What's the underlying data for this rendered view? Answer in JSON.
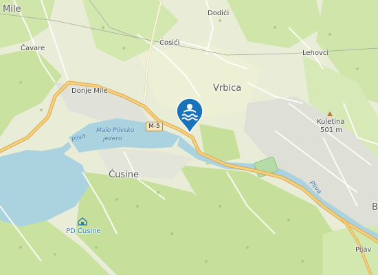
{
  "map": {
    "places": {
      "mile": "Mile",
      "cavare": "Čavare",
      "donje_mile": "Donje Mile",
      "cosici": "Ćosići",
      "dodici": "Dodići",
      "lehovci": "Lehovci",
      "vrbica": "Vrbica",
      "kuletina": "Kuletina",
      "kuletina_elev": "501 m",
      "cusine": "Ćusine",
      "pijav": "Pijav",
      "edge_b": "B"
    },
    "water": {
      "river_pliva_west": "Pliva",
      "lake": "Malo Plivsko jezero",
      "lake_line1": "Malo Plivsko",
      "lake_line2": "jezero",
      "river_pliva_east": "Pliva"
    },
    "road": {
      "shield": "M-5"
    },
    "poi": {
      "lodge": "PD Ćusine"
    },
    "marker": {
      "icon": "swimming-icon",
      "color": "#1a73b8"
    },
    "colors": {
      "water": "#aad3df",
      "forest": "#cfe5a9",
      "land": "#e8ecd4",
      "road": "#f2c26a",
      "urban": "#dcdcd4"
    }
  }
}
